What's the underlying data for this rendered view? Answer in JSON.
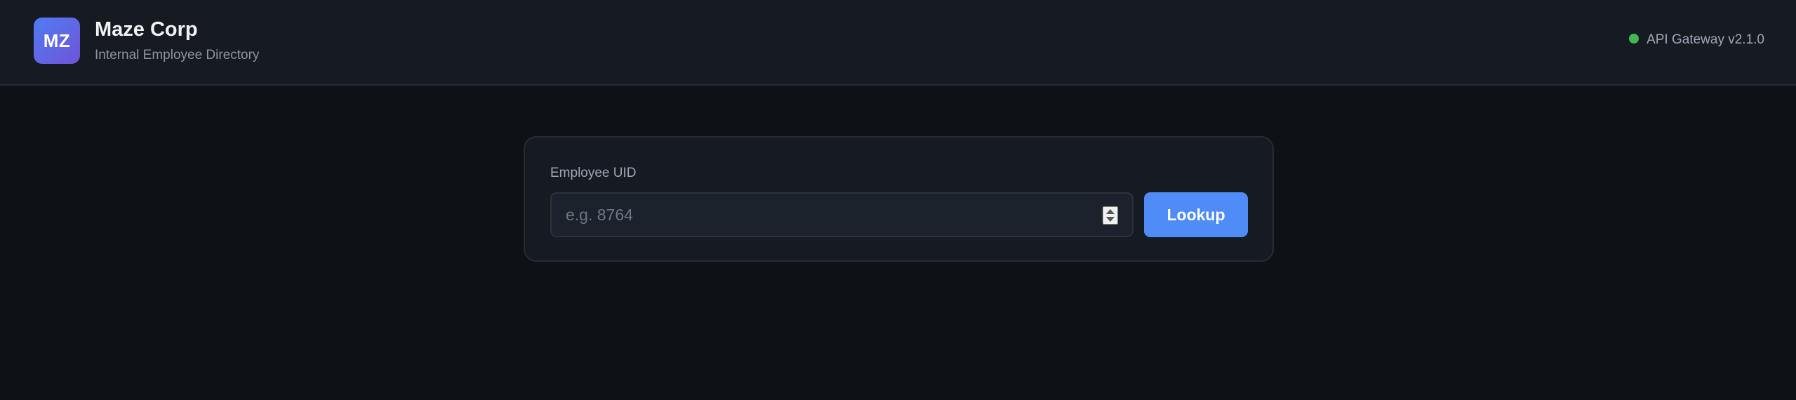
{
  "brand": {
    "logo_text": "MZ",
    "name": "Maze Corp",
    "subtitle": "Internal Employee Directory"
  },
  "status": {
    "label": "API Gateway v2.1.0",
    "color": "#3fb950"
  },
  "form": {
    "label": "Employee UID",
    "input_value": "",
    "placeholder": "e.g. 8764",
    "submit_label": "Lookup"
  },
  "colors": {
    "background": "#0e1116",
    "header": "#161b22",
    "accent": "#4f8cf7",
    "logo_gradient": [
      "#4f7cf7",
      "#6f54d6"
    ]
  },
  "icons": {
    "status": "status-dot-icon",
    "spinner": "number-spinner-icon"
  }
}
